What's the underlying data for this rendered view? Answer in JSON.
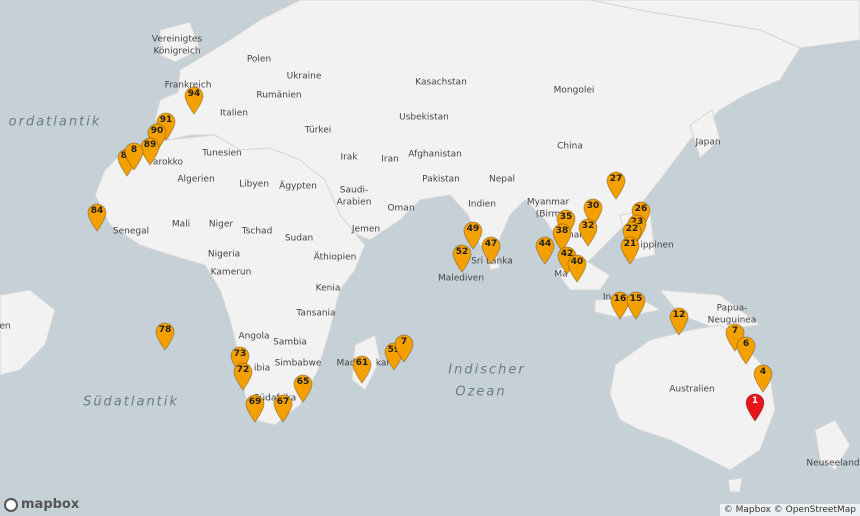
{
  "map": {
    "logo": "mapbox",
    "attribution": "© Mapbox © OpenStreetMap",
    "colors": {
      "water": "#c6d0d7",
      "land": "#f2f2f2",
      "marker": "#f4a000",
      "marker_selected": "#e8151b"
    }
  },
  "labels": {
    "vereinigtes": "Vereinigtes",
    "koenigreich": "Königreich",
    "polen": "Polen",
    "ukraine": "Ukraine",
    "kasachstan": "Kasachstan",
    "mongolei": "Mongolei",
    "frankreich": "Frankreich",
    "rumaenien": "Rumänien",
    "italien": "Italien",
    "tuerkei": "Türkei",
    "usbekistan": "Usbekistan",
    "china": "China",
    "japan": "Japan",
    "nordatlantik": "ordatlantik",
    "tunesien": "Tunesien",
    "irak": "Irak",
    "iran": "Iran",
    "afghanistan": "Afghanistan",
    "marokko": "arokko",
    "algerien": "Algerien",
    "libyen": "Libyen",
    "aegypten": "Ägypten",
    "pakistan": "Pakistan",
    "nepal": "Nepal",
    "saudi": "Saudi-",
    "arabien": "Arabien",
    "oman": "Oman",
    "indien": "Indien",
    "myanmar": "Myanmar",
    "birma": "(Birm",
    "mali": "Mali",
    "niger": "Niger",
    "tschad": "Tschad",
    "sudan": "Sudan",
    "jemen": "Jemen",
    "senegal": "Senegal",
    "aethiopien": "Äthiopien",
    "nigeria": "Nigeria",
    "kamerun": "Kamerun",
    "kenia": "Kenia",
    "srilanka": "Sri Lanka",
    "malediven": "Malediven",
    "philippinen": "ippinen",
    "nam": "nam",
    "malaysia": "Ma",
    "in": "In",
    "tansania": "Tansania",
    "angola": "Angola",
    "sambia": "Sambia",
    "simbabwe": "Simbabwe",
    "bia": "ibia",
    "papua": "Papua-",
    "neuguinea": "Neuguinea",
    "madagaskar": "Mad",
    "kar": "kar",
    "australien": "Australien",
    "suedafrika": "Südafrika",
    "neuseeland": "Neuseeland",
    "en": "en",
    "indischer": "Indischer",
    "ozean": "Ozean",
    "suedatlantik": "Südatlantik"
  },
  "markers": [
    "94",
    "91",
    "90",
    "89",
    "87",
    "8",
    "84",
    "78",
    "73",
    "72",
    "69",
    "67",
    "65",
    "61",
    "59",
    "7",
    "52",
    "49",
    "47",
    "44",
    "35",
    "38",
    "30",
    "32",
    "27",
    "26",
    "23",
    "22",
    "21",
    "42",
    "40",
    "16",
    "15",
    "12",
    "7",
    "6",
    "4",
    "1"
  ]
}
